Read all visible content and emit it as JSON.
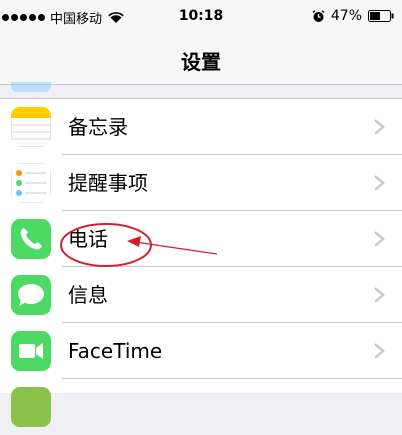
{
  "status_bar": {
    "carrier": "中国移动",
    "time": "10:18",
    "battery": "47%",
    "icons": [
      "signal-dots-icon",
      "wifi-icon",
      "alarm-icon",
      "battery-icon"
    ]
  },
  "nav": {
    "title": "设置"
  },
  "rows": [
    {
      "label": "备忘录",
      "icon": "notes-icon"
    },
    {
      "label": "提醒事项",
      "icon": "reminders-icon"
    },
    {
      "label": "电话",
      "icon": "phone-icon"
    },
    {
      "label": "信息",
      "icon": "messages-icon"
    },
    {
      "label": "FaceTime",
      "icon": "facetime-icon"
    }
  ],
  "colors": {
    "annotation": "#d3212b",
    "phone_green": "#4cd964",
    "notes_yellow": "#ffcc00"
  }
}
